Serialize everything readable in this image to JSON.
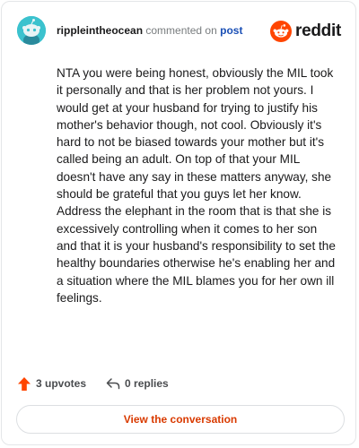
{
  "comment": {
    "author": "rippleintheocean",
    "action_text": "commented on",
    "post_link_label": "post",
    "body": "NTA you were being honest, obviously the MIL took it personally and that is her problem not yours. I would get at your husband for trying to justify his mother's behavior though, not cool. Obviously it's hard to not be biased towards your mother but it's called being an adult. On top of that your MIL doesn't have any say in these matters anyway, she should be grateful that you guys let her know. Address the elephant in the room that is that she is excessively controlling when it comes to her son and that it is your husband's responsibility to set the healthy boundaries otherwise he's enabling her and a situation where the MIL blames you for her own ill feelings.",
    "upvotes_label": "3 upvotes",
    "replies_label": "0 replies",
    "view_conversation_label": "View the conversation"
  },
  "brand": {
    "name": "reddit",
    "accent_color": "#ff4500",
    "avatar_color": "#3bc2ce",
    "link_color": "#1a4fb5",
    "button_text_color": "#d93a00"
  },
  "icons": {
    "avatar": "snoo-avatar-icon",
    "logo": "reddit-logo-icon",
    "upvote": "upvote-arrow-icon",
    "reply": "reply-arrow-icon"
  }
}
